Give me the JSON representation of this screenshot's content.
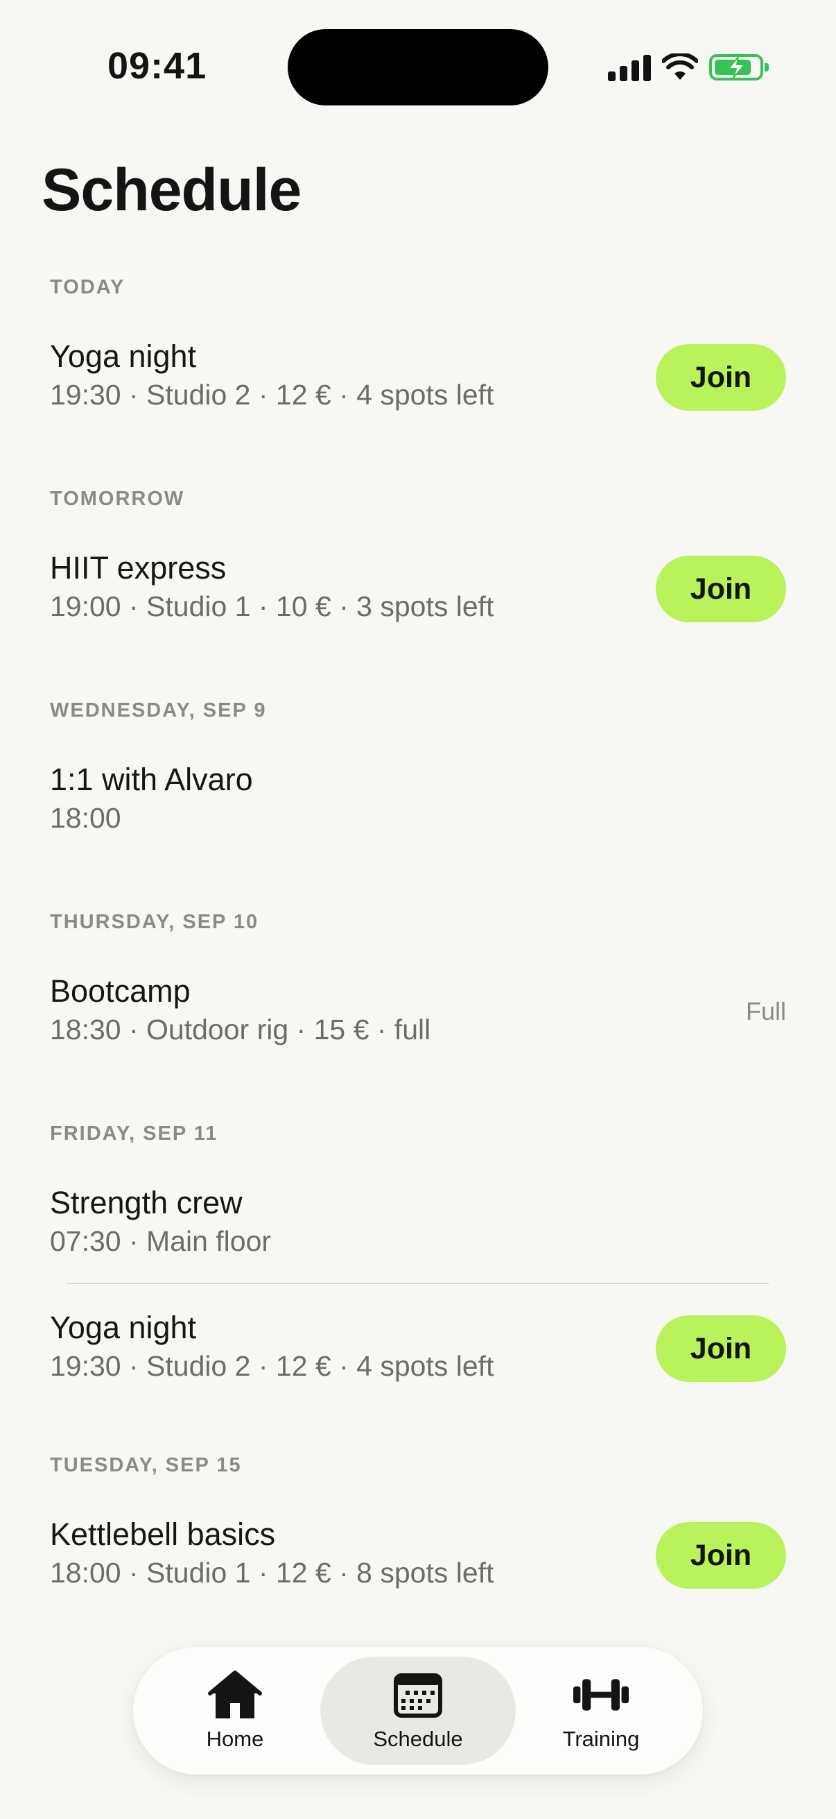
{
  "status_bar": {
    "time": "09:41"
  },
  "page": {
    "title": "Schedule"
  },
  "schedule": {
    "days": [
      {
        "label": "TODAY",
        "items": [
          {
            "title": "Yoga night",
            "meta": "19:30 · Studio 2 · 12 € · 4 spots left",
            "action": "Join"
          }
        ]
      },
      {
        "label": "TOMORROW",
        "items": [
          {
            "title": "HIIT express",
            "meta": "19:00 · Studio 1 · 10 € · 3 spots left",
            "action": "Join"
          }
        ]
      },
      {
        "label": "WEDNESDAY, SEP 9",
        "items": [
          {
            "title": "1:1 with Alvaro",
            "meta": "18:00"
          }
        ]
      },
      {
        "label": "THURSDAY, SEP 10",
        "items": [
          {
            "title": "Bootcamp",
            "meta": "18:30 · Outdoor rig · 15 € · full",
            "status": "Full"
          }
        ]
      },
      {
        "label": "FRIDAY, SEP 11",
        "items": [
          {
            "title": "Strength crew",
            "meta": "07:30 · Main floor"
          },
          {
            "title": "Yoga night",
            "meta": "19:30 · Studio 2 · 12 € · 4 spots left",
            "action": "Join"
          }
        ]
      },
      {
        "label": "TUESDAY, SEP 15",
        "items": [
          {
            "title": "Kettlebell basics",
            "meta": "18:00 · Studio 1 · 12 € · 8 spots left",
            "action": "Join"
          }
        ]
      }
    ]
  },
  "tab_bar": {
    "tabs": [
      {
        "label": "Home",
        "icon": "home-icon",
        "active": false
      },
      {
        "label": "Schedule",
        "icon": "calendar-icon",
        "active": true
      },
      {
        "label": "Training",
        "icon": "dumbbell-icon",
        "active": false
      }
    ]
  },
  "colors": {
    "accent": "#b9f25a",
    "background": "#f7f7f4",
    "muted": "#8a8a86",
    "battery": "#36c256"
  }
}
